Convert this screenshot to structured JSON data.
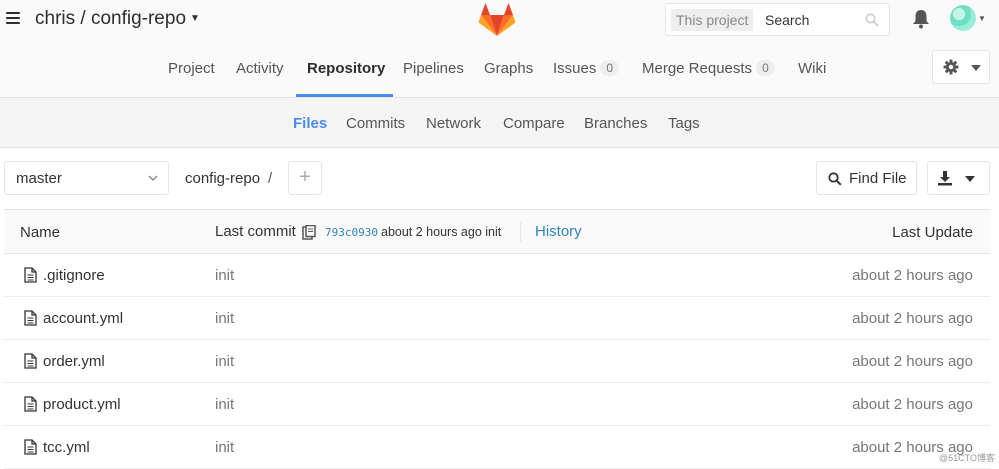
{
  "header": {
    "title": "chris / config-repo",
    "search_scope": "This project",
    "search_placeholder": "Search"
  },
  "project_nav": {
    "items": [
      {
        "label": "Project"
      },
      {
        "label": "Activity"
      },
      {
        "label": "Repository",
        "active": true
      },
      {
        "label": "Pipelines"
      },
      {
        "label": "Graphs"
      },
      {
        "label": "Issues",
        "count": "0"
      },
      {
        "label": "Merge Requests",
        "count": "0"
      },
      {
        "label": "Wiki"
      }
    ]
  },
  "sub_nav": {
    "items": [
      {
        "label": "Files",
        "active": true
      },
      {
        "label": "Commits"
      },
      {
        "label": "Network"
      },
      {
        "label": "Compare"
      },
      {
        "label": "Branches"
      },
      {
        "label": "Tags"
      }
    ]
  },
  "toolbar": {
    "branch": "master",
    "breadcrumb": "config-repo",
    "breadcrumb_sep": "/",
    "add": "+",
    "find_file": "Find File"
  },
  "table": {
    "col_name": "Name",
    "col_commit": "Last commit",
    "commit_sha": "793c0930",
    "commit_meta": "about 2 hours ago init",
    "history": "History",
    "col_update": "Last Update",
    "rows": [
      {
        "name": ".gitignore",
        "message": "init",
        "updated": "about 2 hours ago"
      },
      {
        "name": "account.yml",
        "message": "init",
        "updated": "about 2 hours ago"
      },
      {
        "name": "order.yml",
        "message": "init",
        "updated": "about 2 hours ago"
      },
      {
        "name": "product.yml",
        "message": "init",
        "updated": "about 2 hours ago"
      },
      {
        "name": "tcc.yml",
        "message": "init",
        "updated": "about 2 hours ago"
      }
    ]
  },
  "watermark": "@51CTO博客",
  "colors": {
    "accent": "#4a8bee",
    "link": "#3084bb",
    "logo_orange": "#e24329"
  }
}
